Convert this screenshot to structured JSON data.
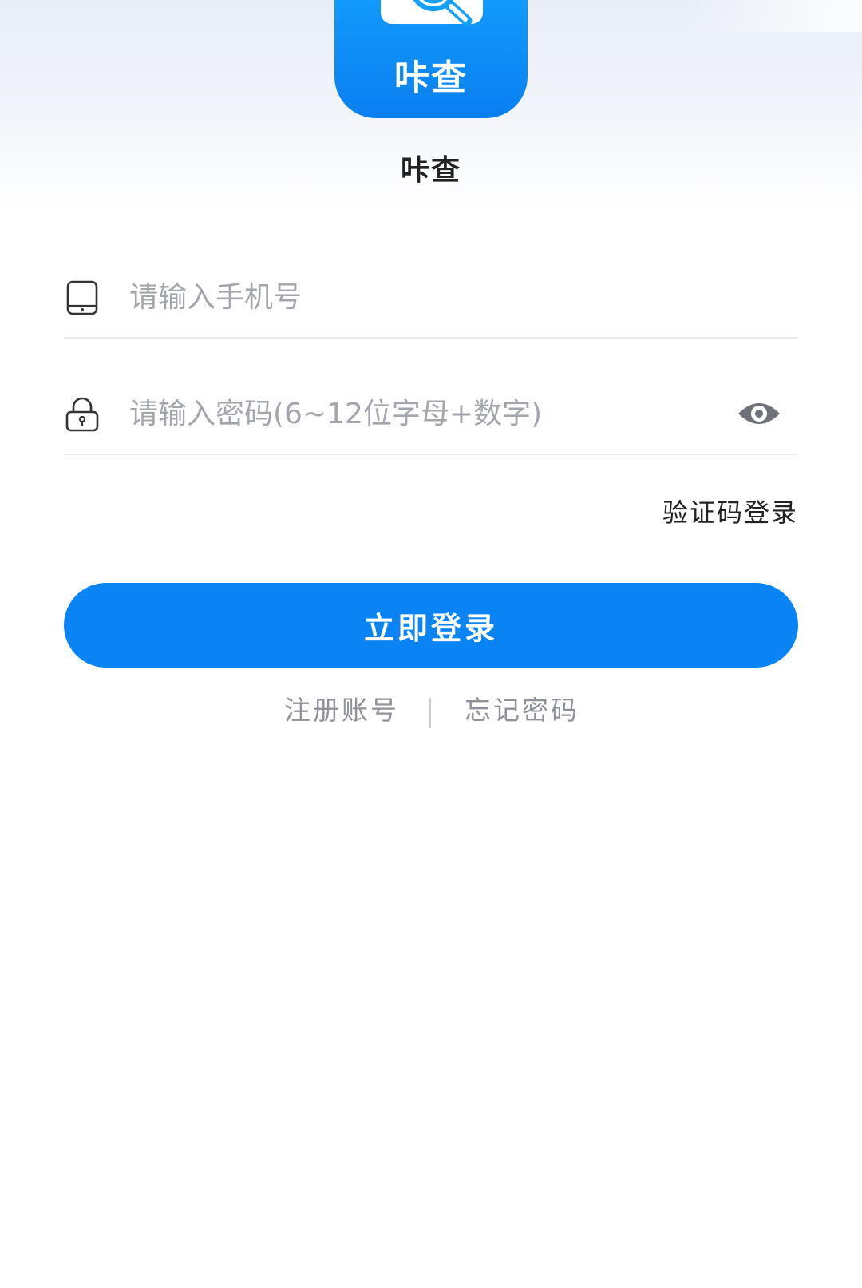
{
  "app": {
    "logo_text": "咔查",
    "name": "咔查",
    "brand_color": "#0a84f5"
  },
  "form": {
    "phone": {
      "icon": "phone-icon",
      "value": "",
      "placeholder": "请输入手机号"
    },
    "password": {
      "icon": "lock-icon",
      "value": "",
      "placeholder": "请输入密码(6~12位字母+数字)",
      "toggle_icon": "eye-icon"
    },
    "code_login_label": "验证码登录",
    "submit_label": "立即登录"
  },
  "footer_links": {
    "register_label": "注册账号",
    "forgot_label": "忘记密码"
  }
}
